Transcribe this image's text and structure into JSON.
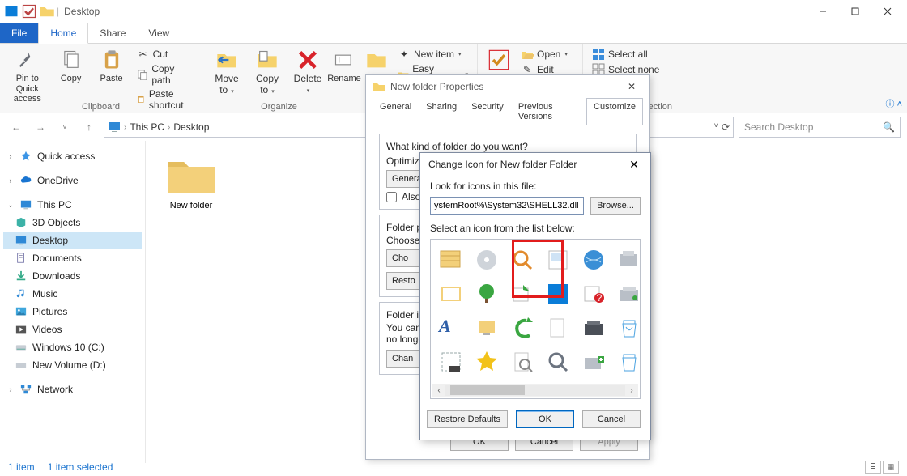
{
  "window": {
    "title": "Desktop"
  },
  "tabs": {
    "file": "File",
    "home": "Home",
    "share": "Share",
    "view": "View"
  },
  "ribbon": {
    "pin": "Pin to Quick\naccess",
    "copy": "Copy",
    "paste": "Paste",
    "cut": "Cut",
    "copypath": "Copy path",
    "pasteshort": "Paste shortcut",
    "clipboard_label": "Clipboard",
    "moveto": "Move\nto",
    "copyto": "Copy\nto",
    "delete": "Delete",
    "rename": "Rename",
    "organize_label": "Organize",
    "newitem": "New item",
    "easyaccess": "Easy access",
    "open": "Open",
    "edit": "Edit",
    "selectall": "Select all",
    "selectnone": "Select none",
    "ection": "ection"
  },
  "nav": {
    "thispc": "This PC",
    "desktop": "Desktop",
    "search_placeholder": "Search Desktop"
  },
  "sidebar": {
    "quick": "Quick access",
    "onedrive": "OneDrive",
    "thispc": "This PC",
    "items": {
      "obj3d": "3D Objects",
      "desktop": "Desktop",
      "documents": "Documents",
      "downloads": "Downloads",
      "music": "Music",
      "pictures": "Pictures",
      "videos": "Videos",
      "c": "Windows 10 (C:)",
      "d": "New Volume (D:)"
    },
    "network": "Network"
  },
  "content": {
    "item_name": "New folder"
  },
  "status": {
    "count": "1 item",
    "sel": "1 item selected"
  },
  "prop": {
    "title": "New folder Properties",
    "tabs": {
      "general": "General",
      "sharing": "Sharing",
      "security": "Security",
      "prev": "Previous Versions",
      "custom": "Customize"
    },
    "kind_q": "What kind of folder do you want?",
    "optimize": "Optimize this folder for:",
    "general": "General",
    "also": "Also",
    "folderp": "Folder p",
    "choose": "Choose",
    "cho": "Cho",
    "resto": "Resto",
    "foldericon": "Folder ic",
    "youcan": "You can",
    "nolonger": "no longer",
    "chan": "Chan",
    "ok": "OK",
    "cancel": "Cancel",
    "apply": "Apply"
  },
  "icon": {
    "title": "Change Icon for New folder Folder",
    "look": "Look for icons in this file:",
    "path": "ystemRoot%\\System32\\SHELL32.dll",
    "browse": "Browse...",
    "select": "Select an icon from the list below:",
    "restore": "Restore Defaults",
    "ok": "OK",
    "cancel": "Cancel"
  }
}
